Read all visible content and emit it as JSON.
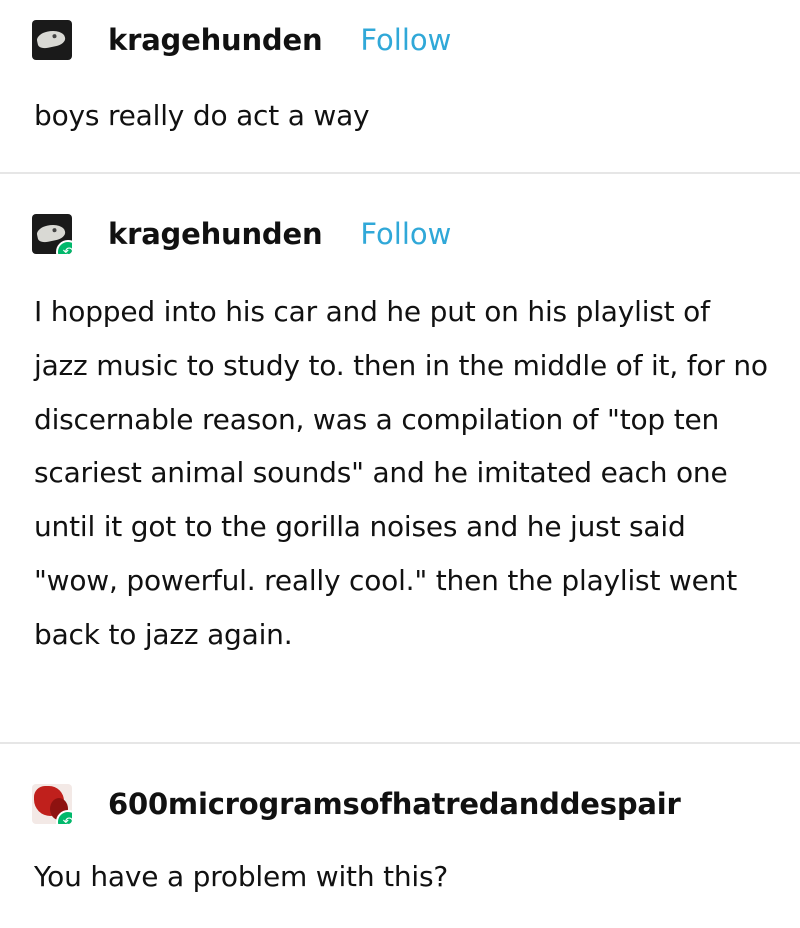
{
  "posts": [
    {
      "username": "kragehunden",
      "follow_label": "Follow",
      "avatar_icon": "skull-avatar",
      "reblog": false,
      "body": "boys really do act a way"
    },
    {
      "username": "kragehunden",
      "follow_label": "Follow",
      "avatar_icon": "skull-avatar",
      "reblog": true,
      "body": "I hopped into his car and he put on his playlist of jazz music to study to. then in the middle of it, for no discernable reason, was a compilation of \"top ten scariest animal sounds\" and he imitated each one until it got to the gorilla noises and he just said \"wow, powerful. really cool.\" then the playlist went back to jazz again."
    },
    {
      "username": "600microgramsofhatredanddespair",
      "avatar_icon": "red-splatter-avatar",
      "reblog": true,
      "body": "You have a problem with this?"
    }
  ],
  "colors": {
    "follow": "#30a8d8",
    "reblog_badge": "#00b86b",
    "divider": "#e6e6e6"
  },
  "icons": {
    "reblog": "reblog-icon"
  }
}
